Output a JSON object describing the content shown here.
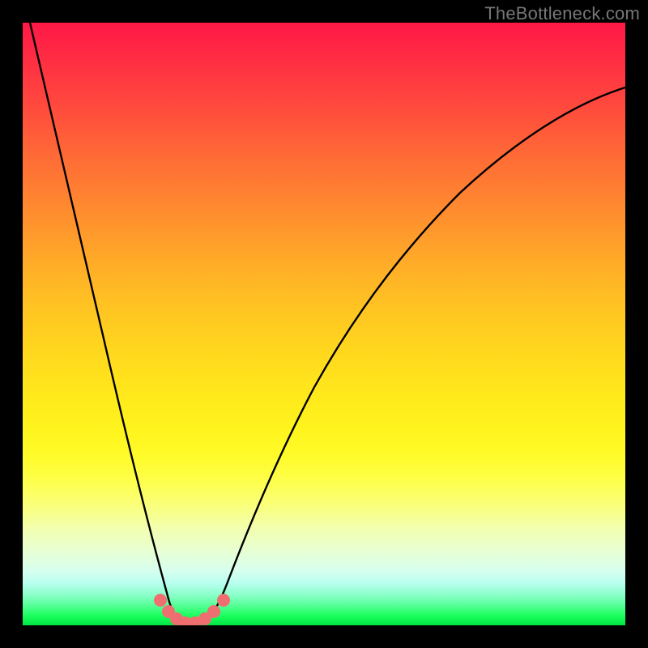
{
  "watermark": "TheBottleneck.com",
  "chart_data": {
    "type": "line",
    "title": "",
    "xlabel": "",
    "ylabel": "",
    "xlim": [
      0,
      1
    ],
    "ylim": [
      0,
      1
    ],
    "grid": false,
    "legend": false,
    "series": [
      {
        "name": "bottleneck-curve",
        "color": "#000000",
        "x": [
          0.0,
          0.05,
          0.1,
          0.15,
          0.2,
          0.238,
          0.26,
          0.28,
          0.3,
          0.32,
          0.34,
          0.37,
          0.4,
          0.45,
          0.5,
          0.55,
          0.6,
          0.68,
          0.76,
          0.84,
          0.92,
          1.0
        ],
        "y": [
          1.0,
          0.79,
          0.58,
          0.37,
          0.155,
          0.0,
          0.0,
          0.0,
          0.0,
          0.0,
          0.033,
          0.12,
          0.2,
          0.32,
          0.42,
          0.5,
          0.57,
          0.66,
          0.73,
          0.79,
          0.84,
          0.88
        ]
      }
    ],
    "markers": {
      "name": "bottleneck-floor-dots",
      "color": "#ef6f71",
      "points": [
        {
          "x": 0.229,
          "y": 0.04
        },
        {
          "x": 0.242,
          "y": 0.02
        },
        {
          "x": 0.255,
          "y": 0.008
        },
        {
          "x": 0.27,
          "y": 0.002
        },
        {
          "x": 0.286,
          "y": 0.002
        },
        {
          "x": 0.302,
          "y": 0.008
        },
        {
          "x": 0.318,
          "y": 0.02
        },
        {
          "x": 0.333,
          "y": 0.04
        }
      ]
    }
  }
}
